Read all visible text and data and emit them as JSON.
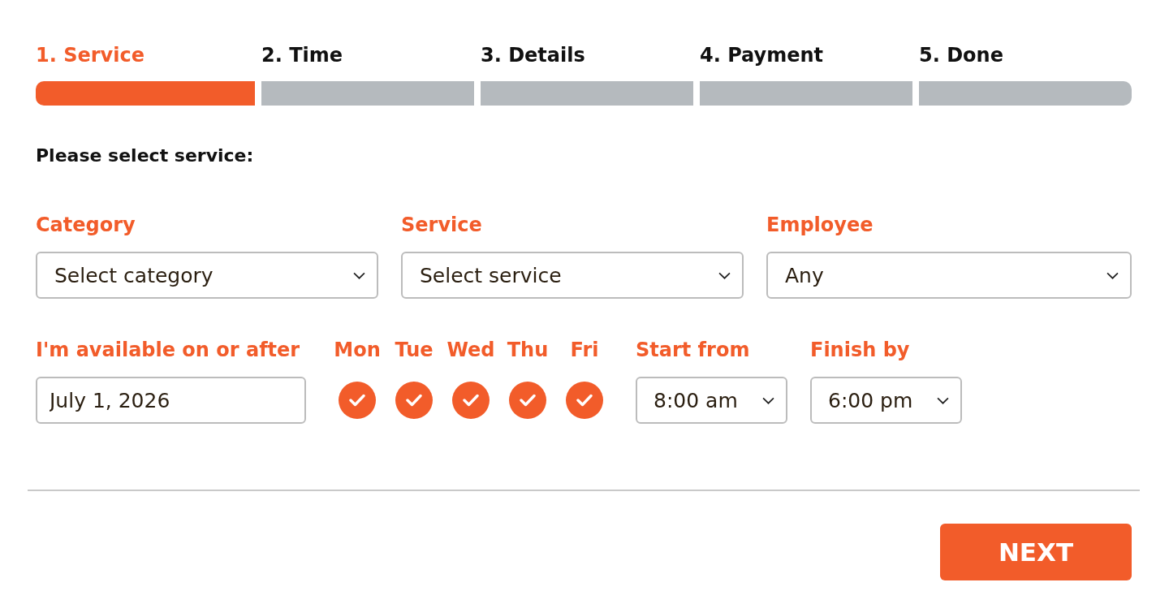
{
  "steps": [
    {
      "label": "1. Service",
      "selected": true
    },
    {
      "label": "2. Time",
      "selected": false
    },
    {
      "label": "3. Details",
      "selected": false
    },
    {
      "label": "4. Payment",
      "selected": false
    },
    {
      "label": "5. Done",
      "selected": false
    }
  ],
  "heading": "Please select service:",
  "fields": [
    {
      "label": "Category",
      "value": "Select category"
    },
    {
      "label": "Service",
      "value": "Select service"
    },
    {
      "label": "Employee",
      "value": "Any"
    }
  ],
  "availability": {
    "date": {
      "label": "I'm available on or after",
      "value": "July 1, 2026"
    },
    "days": [
      {
        "label": "Mon",
        "checked": true
      },
      {
        "label": "Tue",
        "checked": true
      },
      {
        "label": "Wed",
        "checked": true
      },
      {
        "label": "Thu",
        "checked": true
      },
      {
        "label": "Fri",
        "checked": true
      }
    ],
    "start": {
      "label": "Start from",
      "value": "8:00 am"
    },
    "finish": {
      "label": "Finish by",
      "value": "6:00 pm"
    }
  },
  "next_button": "NEXT"
}
